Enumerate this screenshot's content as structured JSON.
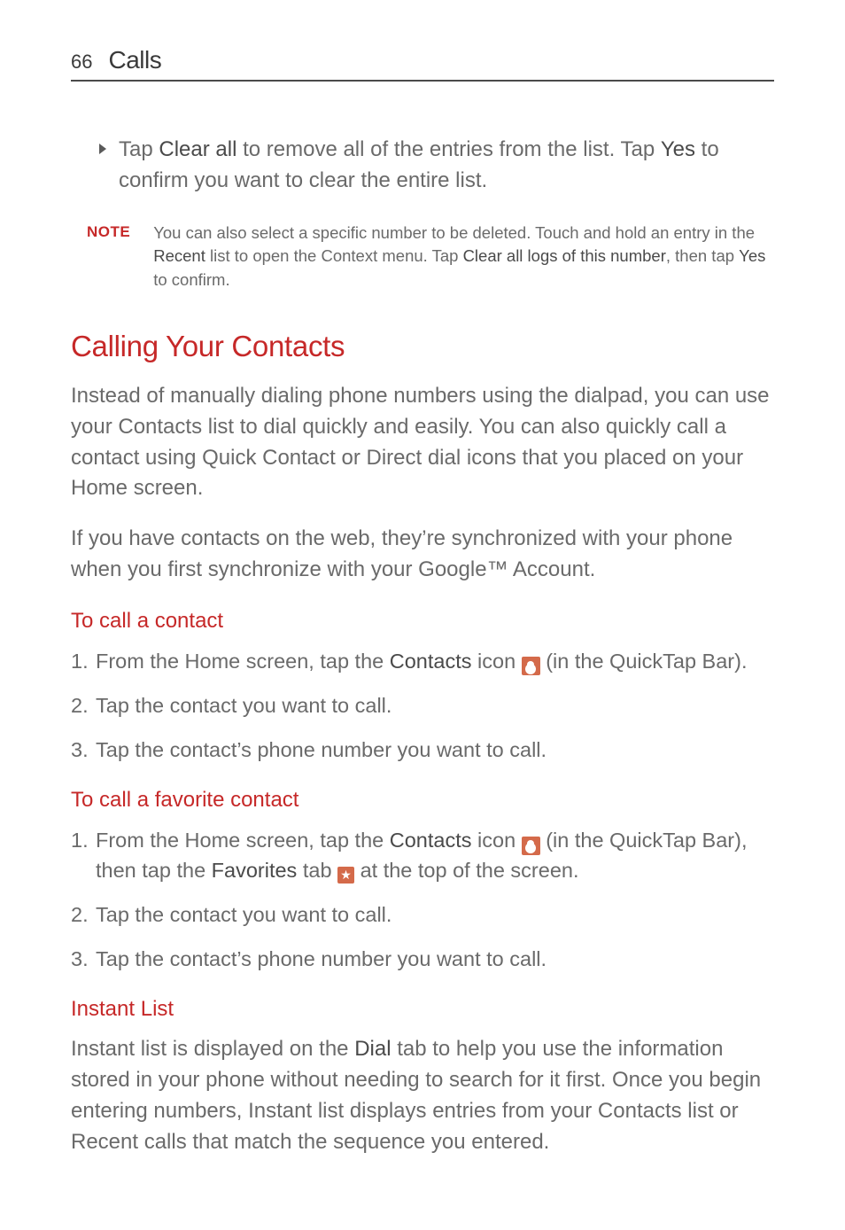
{
  "header": {
    "page_number": "66",
    "section": "Calls"
  },
  "top_bullet": {
    "pre": "Tap ",
    "b1": "Clear all",
    "mid": " to remove all of the entries from the list. Tap ",
    "b2": "Yes",
    "post": " to confirm you want to clear the entire list."
  },
  "note": {
    "label": "NOTE",
    "pre": "You can also select a specific number to be deleted. Touch and hold an entry in the ",
    "b1": "Recent",
    "mid1": " list to open the Context menu. Tap ",
    "b2": "Clear all logs of this number",
    "mid2": ", then tap ",
    "b3": "Yes",
    "post": " to confirm."
  },
  "main_heading": "Calling Your Contacts",
  "para1": "Instead of manually dialing phone numbers using the dialpad, you can use your Contacts list to dial quickly and easily. You can also quickly call a contact using Quick Contact or Direct dial icons that you placed on your Home screen.",
  "para2": "If you have contacts on the web, they’re synchronized with your phone when you first synchronize with your Google™ Account.",
  "sec_call_contact": {
    "heading": "To call a contact",
    "s1": {
      "num": "1.",
      "pre": "From the Home screen, tap the ",
      "b1": "Contacts",
      "mid": " icon ",
      "post": " (in the QuickTap Bar)."
    },
    "s2": {
      "num": "2.",
      "text": "Tap the contact you want to call."
    },
    "s3": {
      "num": "3.",
      "text": "Tap the contact’s phone number you want to call."
    }
  },
  "sec_call_fav": {
    "heading": "To call a favorite contact",
    "s1": {
      "num": "1.",
      "pre": "From the Home screen, tap the ",
      "b1": "Contacts",
      "mid1": " icon ",
      "mid2": " (in the QuickTap Bar), then tap the ",
      "b2": "Favorites",
      "mid3": " tab ",
      "post": " at the top of the screen."
    },
    "s2": {
      "num": "2.",
      "text": "Tap the contact you want to call."
    },
    "s3": {
      "num": "3.",
      "text": "Tap the contact’s phone number you want to call."
    }
  },
  "sec_instant": {
    "heading": "Instant List",
    "para_pre": "Instant list is displayed on the ",
    "para_b1": "Dial",
    "para_post": " tab to help you use the information stored in your phone without needing to search for it first. Once you begin entering numbers, Instant list displays entries from your Contacts list or Recent calls that match the sequence you entered."
  },
  "icons": {
    "star_glyph": "★"
  }
}
